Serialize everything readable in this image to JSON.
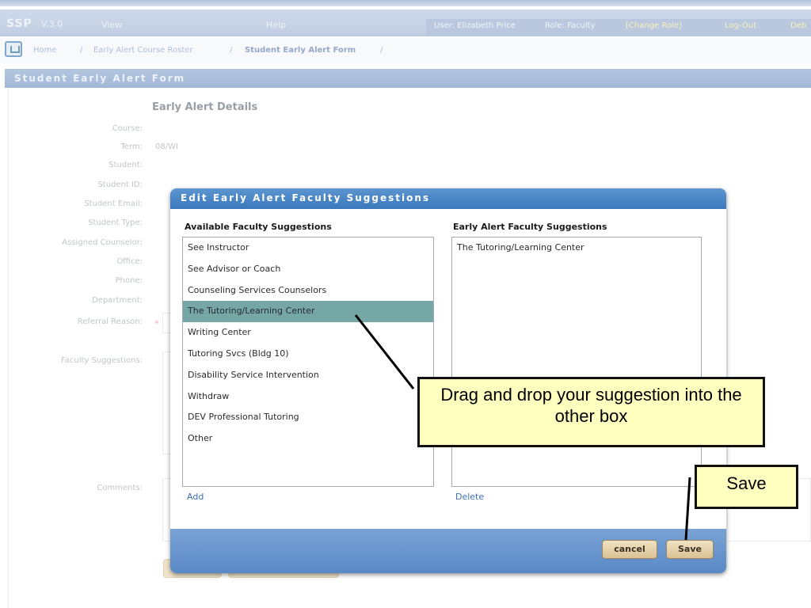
{
  "topnav": {
    "logo": "SSP",
    "version": "V.3.0",
    "menu": [
      "View",
      "Help"
    ],
    "user": "User: Elizabeth Price",
    "role": "Role: Faculty",
    "change_role": "[Change Role]",
    "logout": "Log-Out",
    "extra": "Deb"
  },
  "breadcrumb": {
    "items": [
      "Home",
      "/",
      "Early Alert Course Roster",
      "/",
      "Student Early Alert Form",
      "/"
    ]
  },
  "page": {
    "section_title": "Student Early Alert Form",
    "details_heading": "Early Alert Details",
    "fields": [
      {
        "label": "Course:",
        "value": ""
      },
      {
        "label": "Term:",
        "value": "08/WI"
      },
      {
        "label": "Student:",
        "value": ""
      },
      {
        "label": "Student ID:",
        "value": ""
      },
      {
        "label": "Student Email:",
        "value": ""
      },
      {
        "label": "Student Type:",
        "value": ""
      },
      {
        "label": "Assigned Counselor:",
        "value": ""
      },
      {
        "label": "Office:",
        "value": ""
      },
      {
        "label": "Phone:",
        "value": ""
      },
      {
        "label": "Department:",
        "value": ""
      },
      {
        "label": "Referral Reason:",
        "value": ""
      }
    ],
    "required_marker": "*",
    "faculty_suggestions_label": "Faculty Suggestions:",
    "comments_label": "Comments:"
  },
  "dialog": {
    "title": "Edit Early Alert Faculty Suggestions",
    "available_heading": "Available Faculty Suggestions",
    "selected_heading": "Early Alert Faculty Suggestions",
    "available_items": [
      "See Instructor",
      "See Advisor or Coach",
      "Counseling Services Counselors",
      "The Tutoring/Learning Center",
      "Writing Center",
      "Tutoring Svcs (Bldg 10)",
      "Disability Service Intervention",
      "Withdraw",
      "DEV Professional Tutoring",
      "Other"
    ],
    "selected_available_index": 3,
    "selected_items": [
      "The Tutoring/Learning Center"
    ],
    "add_label": "Add",
    "delete_label": "Delete",
    "cancel_label": "cancel",
    "save_label": "Save"
  },
  "annotations": {
    "drag_hint": "Drag and drop your suggestion into the other box",
    "save_hint": "Save"
  },
  "colors": {
    "dialog_title": "#3a78bd",
    "dialog_footer": "#5a89c6",
    "selected_row": "#74a7a6",
    "callout_fill": "#ffffc0",
    "button": "#d9c293"
  }
}
